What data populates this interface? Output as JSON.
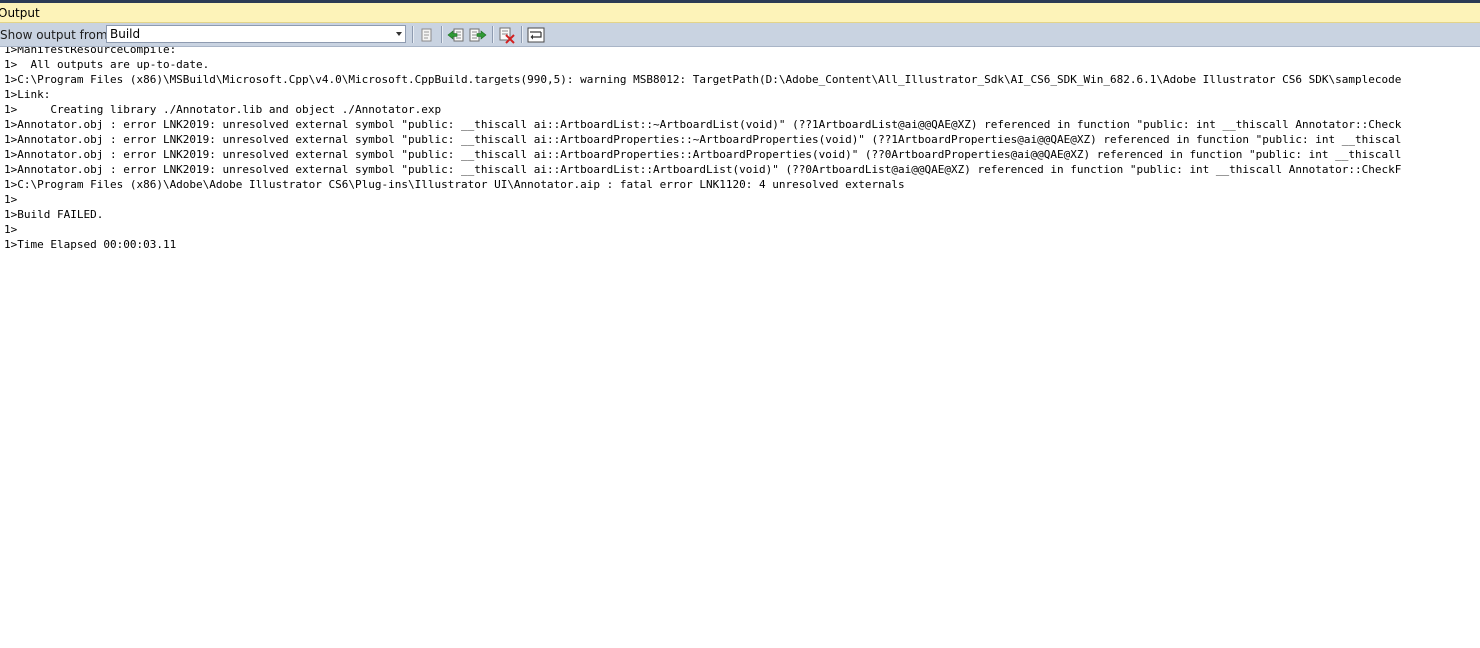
{
  "panel": {
    "title": "Output"
  },
  "toolbar": {
    "show_output_label": "Show output from:",
    "source_selected": "Build",
    "buttons": [
      {
        "name": "find-message-in-code-button",
        "icon": "goto-code-icon"
      },
      {
        "name": "go-to-previous-message-button",
        "icon": "previous-message-icon"
      },
      {
        "name": "go-to-next-message-button",
        "icon": "next-message-icon"
      },
      {
        "name": "clear-all-button",
        "icon": "clear-all-icon"
      },
      {
        "name": "toggle-word-wrap-button",
        "icon": "word-wrap-icon"
      }
    ]
  },
  "output_lines": [
    "1>ManifestResourceCompile:",
    "1>  All outputs are up-to-date.",
    "1>C:\\Program Files (x86)\\MSBuild\\Microsoft.Cpp\\v4.0\\Microsoft.CppBuild.targets(990,5): warning MSB8012: TargetPath(D:\\Adobe_Content\\All_Illustrator_Sdk\\AI_CS6_SDK_Win_682.6.1\\Adobe Illustrator CS6 SDK\\samplecode",
    "1>Link:",
    "1>     Creating library ./Annotator.lib and object ./Annotator.exp",
    "1>Annotator.obj : error LNK2019: unresolved external symbol \"public: __thiscall ai::ArtboardList::~ArtboardList(void)\" (??1ArtboardList@ai@@QAE@XZ) referenced in function \"public: int __thiscall Annotator::Check",
    "1>Annotator.obj : error LNK2019: unresolved external symbol \"public: __thiscall ai::ArtboardProperties::~ArtboardProperties(void)\" (??1ArtboardProperties@ai@@QAE@XZ) referenced in function \"public: int __thiscal",
    "1>Annotator.obj : error LNK2019: unresolved external symbol \"public: __thiscall ai::ArtboardProperties::ArtboardProperties(void)\" (??0ArtboardProperties@ai@@QAE@XZ) referenced in function \"public: int __thiscall",
    "1>Annotator.obj : error LNK2019: unresolved external symbol \"public: __thiscall ai::ArtboardList::ArtboardList(void)\" (??0ArtboardList@ai@@QAE@XZ) referenced in function \"public: int __thiscall Annotator::CheckF",
    "1>C:\\Program Files (x86)\\Adobe\\Adobe Illustrator CS6\\Plug-ins\\Illustrator UI\\Annotator.aip : fatal error LNK1120: 4 unresolved externals",
    "1>",
    "1>Build FAILED.",
    "1>",
    "1>Time Elapsed 00:00:03.11"
  ]
}
